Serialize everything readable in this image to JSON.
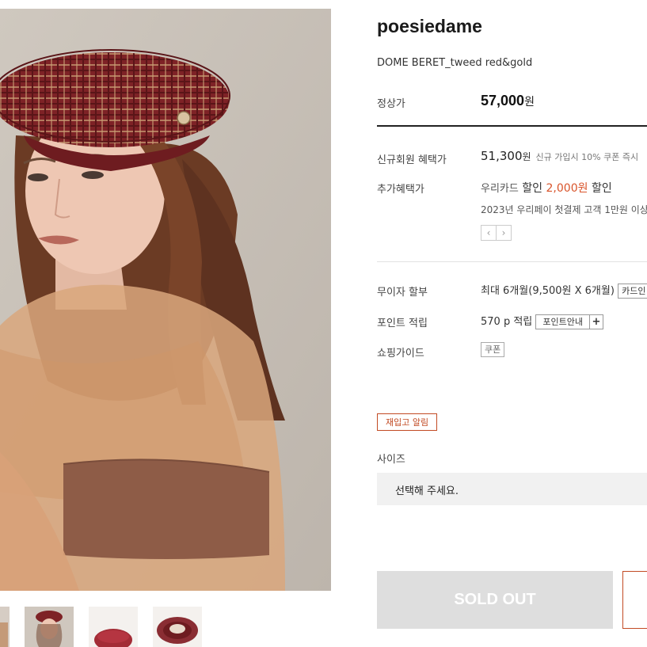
{
  "product": {
    "brand": "poesiedame",
    "name": "DOME BERET_tweed red&gold",
    "price_label": "정상가",
    "price_value": "57,000",
    "currency": "원"
  },
  "member_price": {
    "label": "신규회원 혜택가",
    "value": "51,300",
    "currency": "원",
    "note": "신규 가입시 10% 쿠폰 즉시"
  },
  "extra_benefit": {
    "label": "추가혜택가",
    "card_name": "우리카드",
    "discount_word": "할인",
    "amount": "2,000원",
    "discount_word2": "할인",
    "detail": "2023년 우리페이 첫결제 고객 1만원 이상",
    "prev_icon": "chevron-left-icon",
    "next_icon": "chevron-right-icon"
  },
  "installment": {
    "label": "무이자 할부",
    "value": "최대 6개월(9,500원 X 6개월)",
    "button": "카드인"
  },
  "points": {
    "label": "포인트 적립",
    "value": "570 p 적립",
    "info_button": "포인트안내",
    "plus": "+"
  },
  "shopping_guide": {
    "label": "쇼핑가이드",
    "coupon_button": "쿠폰"
  },
  "restock_button": "재입고 알림",
  "size": {
    "label": "사이즈",
    "placeholder": "선택해 주세요."
  },
  "soldout_button": "SOLD OUT",
  "colors": {
    "accent": "#c24b24",
    "discount_red": "#d9542b",
    "soldout_bg": "#dedede",
    "select_bg": "#f1f1f1"
  }
}
